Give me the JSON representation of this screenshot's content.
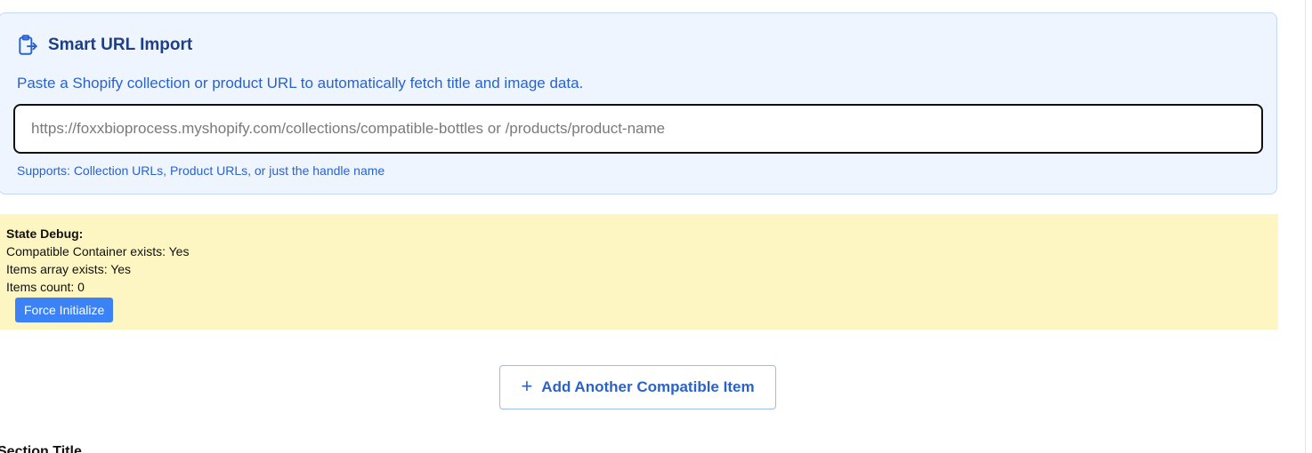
{
  "smart_import": {
    "title": "Smart URL Import",
    "icon": "clipboard-import-icon",
    "description": "Paste a Shopify collection or product URL to automatically fetch title and image data.",
    "url_input": {
      "value": "",
      "placeholder": "https://foxxbioprocess.myshopify.com/collections/compatible-bottles or /products/product-name"
    },
    "help_text": "Supports: Collection URLs, Product URLs, or just the handle name"
  },
  "debug": {
    "title": "State Debug:",
    "lines": [
      "Compatible Container exists: Yes",
      "Items array exists: Yes",
      "Items count: 0"
    ],
    "force_button_label": "Force Initialize"
  },
  "add_item": {
    "plus_symbol": "+",
    "label": "Add Another Compatible Item"
  },
  "next_section": {
    "title_fragment": "Section Title"
  },
  "colors": {
    "card_bg": "#eef5ff",
    "accent": "#2a62cc",
    "debug_bg": "#fdf6c3",
    "primary_button": "#3b82f6"
  }
}
